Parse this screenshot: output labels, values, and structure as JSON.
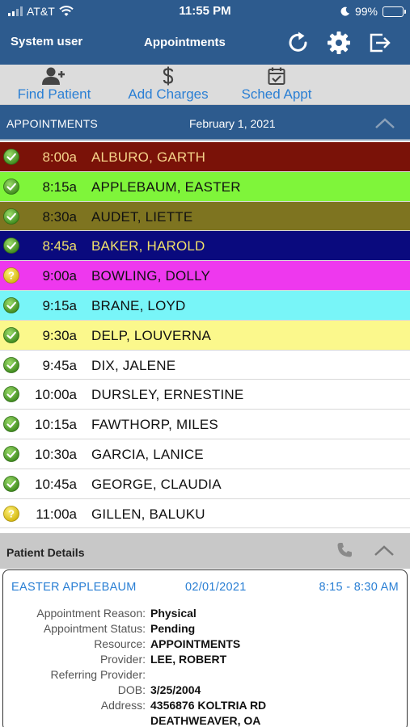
{
  "status_bar": {
    "carrier": "AT&T",
    "time": "11:55 PM",
    "battery": "99%"
  },
  "header": {
    "user": "System user",
    "title": "Appointments"
  },
  "toolbar": {
    "find_patient": "Find Patient",
    "add_charges": "Add Charges",
    "sched_appt": "Sched Appt"
  },
  "appointments_header": {
    "label": "APPOINTMENTS",
    "date": "February 1, 2021"
  },
  "appointments": [
    {
      "time": "8:00a",
      "name": "ALBURO, GARTH",
      "status": "checked",
      "bg": "#7a1208",
      "fg": "#f5d38a"
    },
    {
      "time": "8:15a",
      "name": "APPLEBAUM, EASTER",
      "status": "checked",
      "bg": "#7ff53a",
      "fg": "#111111"
    },
    {
      "time": "8:30a",
      "name": "AUDET, LIETTE",
      "status": "checked",
      "bg": "#7e7420",
      "fg": "#111111"
    },
    {
      "time": "8:45a",
      "name": "BAKER, HAROLD",
      "status": "checked",
      "bg": "#0a0a7e",
      "fg": "#f0e06a"
    },
    {
      "time": "9:00a",
      "name": "BOWLING, DOLLY",
      "status": "pending",
      "bg": "#ee38ee",
      "fg": "#111111"
    },
    {
      "time": "9:15a",
      "name": "BRANE, LOYD",
      "status": "checked",
      "bg": "#78f5f8",
      "fg": "#111111"
    },
    {
      "time": "9:30a",
      "name": "DELP, LOUVERNA",
      "status": "checked",
      "bg": "#fbf88c",
      "fg": "#111111"
    },
    {
      "time": "9:45a",
      "name": "DIX, JALENE",
      "status": "checked",
      "bg": "#ffffff",
      "fg": "#111111"
    },
    {
      "time": "10:00a",
      "name": "DURSLEY, ERNESTINE",
      "status": "checked",
      "bg": "#ffffff",
      "fg": "#111111"
    },
    {
      "time": "10:15a",
      "name": "FAWTHORP, MILES",
      "status": "checked",
      "bg": "#ffffff",
      "fg": "#111111"
    },
    {
      "time": "10:30a",
      "name": "GARCIA, LANICE",
      "status": "checked",
      "bg": "#ffffff",
      "fg": "#111111"
    },
    {
      "time": "10:45a",
      "name": "GEORGE, CLAUDIA",
      "status": "checked",
      "bg": "#ffffff",
      "fg": "#111111"
    },
    {
      "time": "11:00a",
      "name": "GILLEN, BALUKU",
      "status": "pending",
      "bg": "#ffffff",
      "fg": "#111111"
    }
  ],
  "patient_details": {
    "label": "Patient Details",
    "name": "EASTER APPLEBAUM",
    "date": "02/01/2021",
    "time_range": "8:15 - 8:30 AM",
    "fields": [
      {
        "key": "Appointment Reason:",
        "value": "Physical"
      },
      {
        "key": "Appointment Status:",
        "value": "Pending"
      },
      {
        "key": "Resource:",
        "value": "APPOINTMENTS"
      },
      {
        "key": "Provider:",
        "value": "LEE, ROBERT"
      },
      {
        "key": "Referring Provider:",
        "value": ""
      },
      {
        "key": "DOB:",
        "value": "3/25/2004"
      },
      {
        "key": "Address:",
        "value": "4356876 KOLTRIA RD"
      },
      {
        "key": "",
        "value": "DEATHWEAVER, OA"
      }
    ]
  },
  "colors": {
    "header_blue": "#2d5b8e",
    "link_blue": "#2a7fd4",
    "toolbar_gray": "#dcdcdc",
    "check_green": "#5aa82e",
    "pending_yellow": "#e8d21e"
  }
}
